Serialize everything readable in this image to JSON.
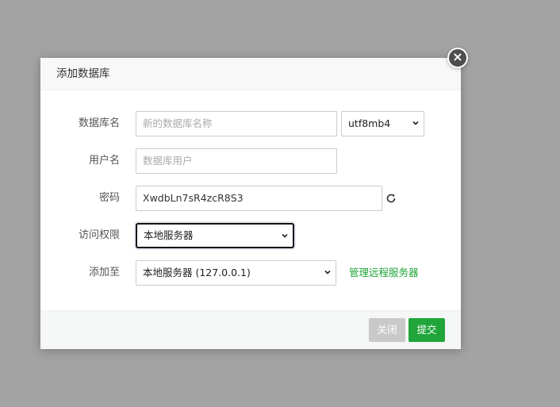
{
  "dialog": {
    "title": "添加数据库",
    "close_symbol": "×"
  },
  "form": {
    "db_name": {
      "label": "数据库名",
      "placeholder": "新的数据库名称",
      "value": ""
    },
    "charset": {
      "value": "utf8mb4"
    },
    "username": {
      "label": "用户名",
      "placeholder": "数据库用户",
      "value": ""
    },
    "password": {
      "label": "密码",
      "value": "XwdbLn7sR4zcR8S3",
      "refresh_icon": "refresh-icon"
    },
    "access": {
      "label": "访问权限",
      "value": "本地服务器"
    },
    "add_to": {
      "label": "添加至",
      "value": "本地服务器 (127.0.0.1)",
      "link": "管理远程服务器"
    }
  },
  "footer": {
    "close_label": "关闭",
    "submit_label": "提交"
  },
  "colors": {
    "accent": "#20a53a",
    "overlay": "#a3a3a3",
    "disabled_button": "#c9c9c9"
  }
}
